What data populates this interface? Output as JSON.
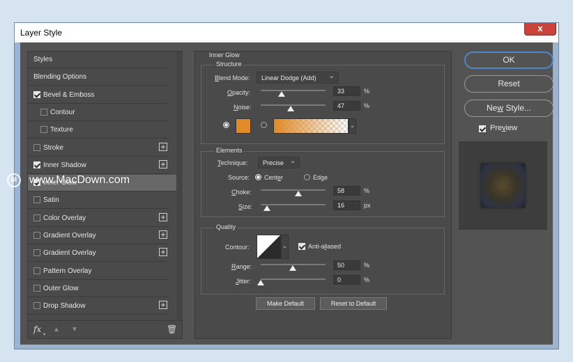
{
  "window": {
    "title": "Layer Style",
    "close_glyph": "x"
  },
  "styles_list": {
    "items": [
      {
        "label": "Styles",
        "checkbox": null,
        "plus": false
      },
      {
        "label": "Blending Options",
        "checkbox": null,
        "plus": false
      },
      {
        "label": "Bevel & Emboss",
        "checkbox": true,
        "plus": false
      },
      {
        "label": "Contour",
        "checkbox": false,
        "plus": false,
        "indent": true
      },
      {
        "label": "Texture",
        "checkbox": false,
        "plus": false,
        "indent": true
      },
      {
        "label": "Stroke",
        "checkbox": false,
        "plus": true
      },
      {
        "label": "Inner Shadow",
        "checkbox": true,
        "plus": true
      },
      {
        "label": "Inner Glow",
        "checkbox": true,
        "plus": false,
        "selected": true
      },
      {
        "label": "Satin",
        "checkbox": false,
        "plus": false
      },
      {
        "label": "Color Overlay",
        "checkbox": false,
        "plus": true
      },
      {
        "label": "Gradient Overlay",
        "checkbox": false,
        "plus": true
      },
      {
        "label": "Gradient Overlay",
        "checkbox": false,
        "plus": true
      },
      {
        "label": "Pattern Overlay",
        "checkbox": false,
        "plus": false
      },
      {
        "label": "Outer Glow",
        "checkbox": false,
        "plus": false
      },
      {
        "label": "Drop Shadow",
        "checkbox": false,
        "plus": true
      }
    ],
    "footer": {
      "fx": "fx",
      "up_icon": "arrow-up-icon",
      "down_icon": "arrow-down-icon",
      "trash_icon": "trash-icon"
    }
  },
  "watermark": "www.MacDown.com",
  "inner_glow": {
    "title": "Inner Glow",
    "structure": {
      "title": "Structure",
      "blend_mode_label_u": "B",
      "blend_mode_label_rest": "lend Mode:",
      "blend_mode_value": "Linear Dodge (Add)",
      "opacity_label_u": "O",
      "opacity_label_rest": "pacity:",
      "opacity_value": "33",
      "opacity_unit": "%",
      "noise_label_u": "N",
      "noise_label_rest": "oise:",
      "noise_value": "47",
      "noise_unit": "%",
      "glow_color": "#e08a28"
    },
    "elements": {
      "title": "Elements",
      "technique_label_u": "T",
      "technique_label_rest": "echnique:",
      "technique_value": "Precise",
      "source_label": "Source:",
      "source_center_pre": "Cent",
      "source_center_u": "e",
      "source_center_post": "r",
      "source_edge_pre": "Ed",
      "source_edge_u": "g",
      "source_edge_post": "e",
      "choke_label_u": "C",
      "choke_label_rest": "hoke:",
      "choke_value": "58",
      "choke_unit": "%",
      "size_label_u": "S",
      "size_label_rest": "ize:",
      "size_value": "16",
      "size_unit": "px"
    },
    "quality": {
      "title": "Quality",
      "contour_label": "Contour:",
      "anti_aliased_pre": "Anti-a",
      "anti_aliased_u": "l",
      "anti_aliased_post": "iased",
      "range_label_u": "R",
      "range_label_rest": "ange:",
      "range_value": "50",
      "range_unit": "%",
      "jitter_label_u": "J",
      "jitter_label_rest": "itter:",
      "jitter_value": "0",
      "jitter_unit": "%"
    },
    "make_default": "Make Default",
    "reset_default": "Reset to Default"
  },
  "right_buttons": {
    "ok": "OK",
    "reset": "Reset",
    "new_style_pre": "Ne",
    "new_style_u": "w",
    "new_style_post": " Style...",
    "preview_pre": "Pre",
    "preview_u": "v",
    "preview_post": "iew"
  },
  "colors": {
    "accent": "#4f86c6",
    "dialog_bg": "#535353",
    "glow_orange": "#e08a28"
  }
}
